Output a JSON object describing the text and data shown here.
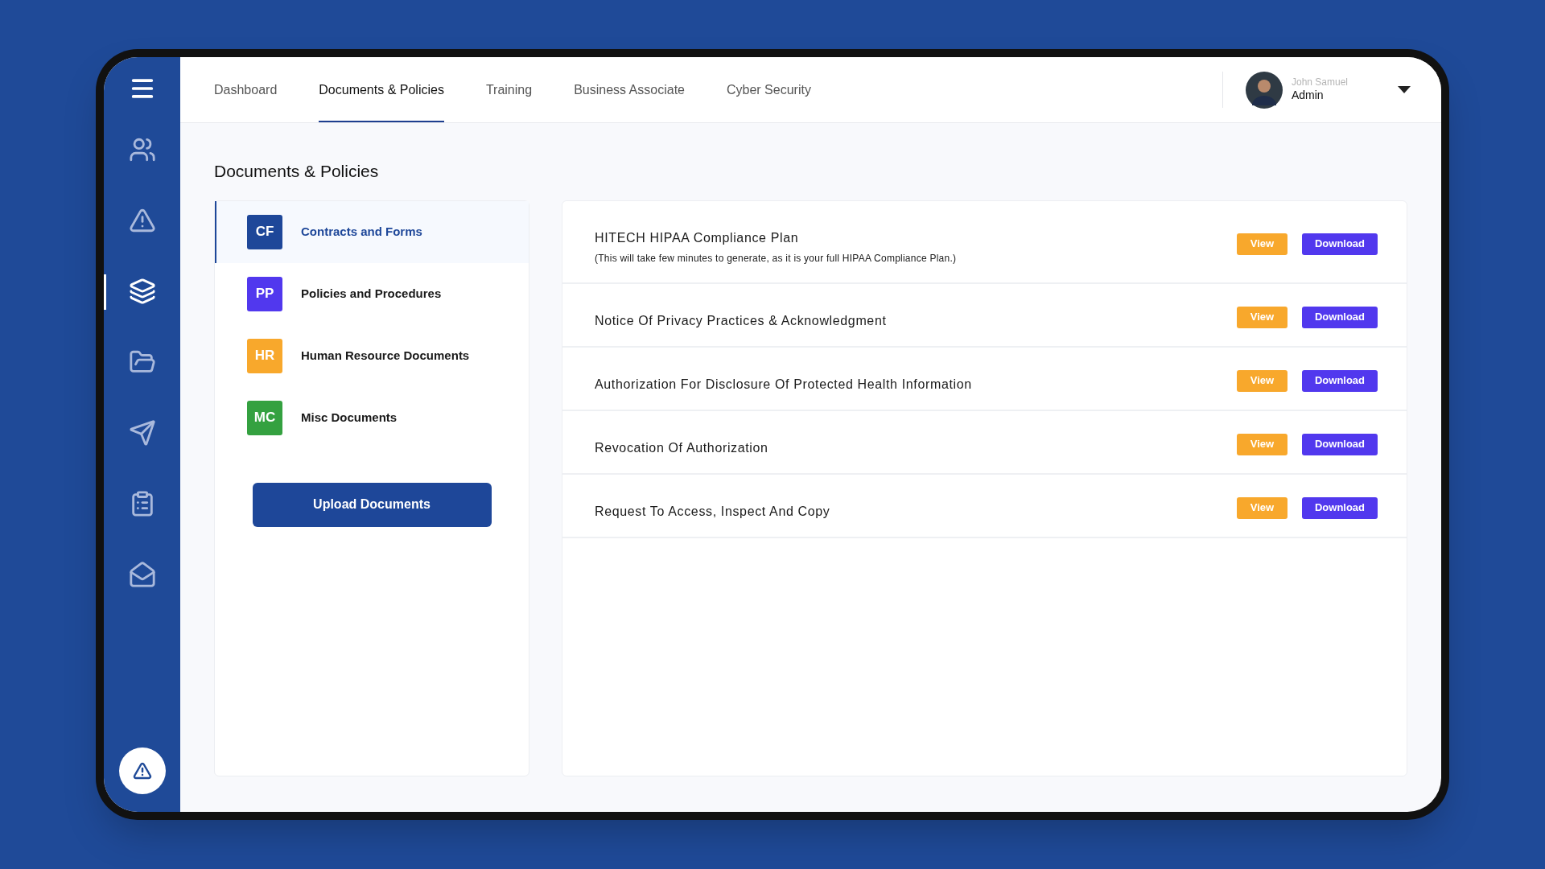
{
  "sidebar": {
    "items": [
      {
        "selected": false
      },
      {
        "selected": false
      },
      {
        "selected": true
      },
      {
        "selected": false
      },
      {
        "selected": false
      },
      {
        "selected": false
      },
      {
        "selected": false
      }
    ]
  },
  "tabs": [
    {
      "label": "Dashboard",
      "selected": false
    },
    {
      "label": "Documents & Policies",
      "selected": true
    },
    {
      "label": "Training",
      "selected": false
    },
    {
      "label": "Business Associate",
      "selected": false
    },
    {
      "label": "Cyber Security",
      "selected": false
    }
  ],
  "user": {
    "name": "John Samuel",
    "role": "Admin"
  },
  "page_title": "Documents & Policies",
  "categories": [
    {
      "badge": "CF",
      "label": "Contracts and Forms",
      "color": "#1e4799",
      "selected": true
    },
    {
      "badge": "PP",
      "label": "Policies and Procedures",
      "color": "#5138ee",
      "selected": false
    },
    {
      "badge": "HR",
      "label": "Human Resource Documents",
      "color": "#f8a82c",
      "selected": false
    },
    {
      "badge": "MC",
      "label": "Misc Documents",
      "color": "#34a140",
      "selected": false
    }
  ],
  "upload_button": "Upload Documents",
  "documents": [
    {
      "title": "HITECH HIPAA Compliance Plan",
      "note": "(This will take few minutes to generate, as it is your full HIPAA Compliance Plan.)",
      "view": "View",
      "download": "Download"
    },
    {
      "title": "Notice Of Privacy Practices & Acknowledgment",
      "view": "View",
      "download": "Download"
    },
    {
      "title": "Authorization For Disclosure Of Protected Health Information",
      "view": "View",
      "download": "Download"
    },
    {
      "title": "Revocation Of Authorization",
      "view": "View",
      "download": "Download"
    },
    {
      "title": "Request To Access, Inspect And Copy",
      "view": "View",
      "download": "Download"
    }
  ]
}
